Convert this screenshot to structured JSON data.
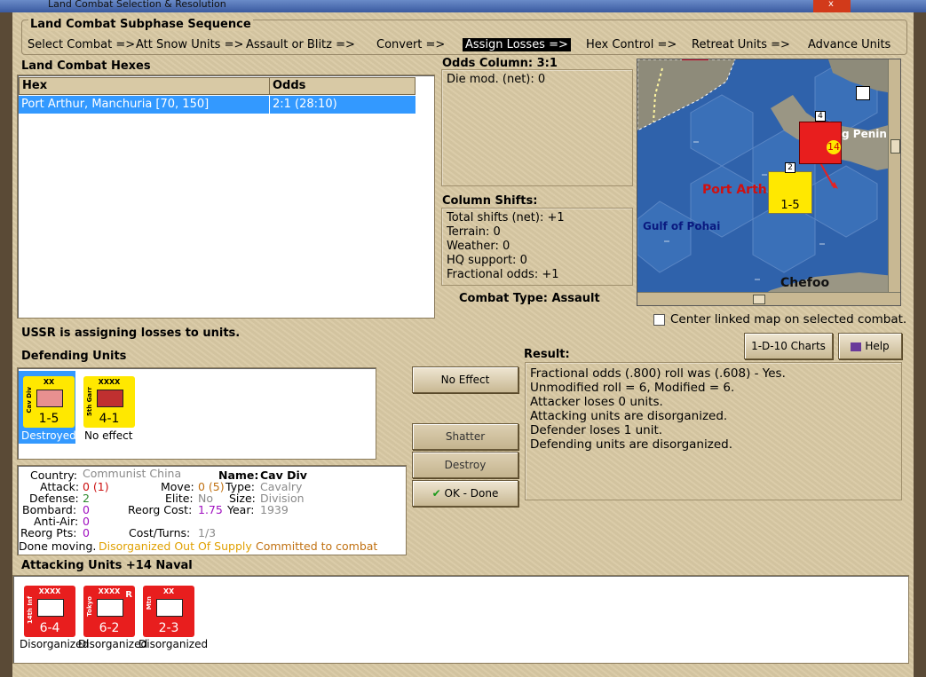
{
  "window": {
    "title": "Land Combat Selection & Resolution",
    "close_label": "x"
  },
  "sequence": {
    "title": "Land Combat Subphase Sequence",
    "steps": [
      {
        "label": "Select Combat =>",
        "active": false
      },
      {
        "label": "Att Snow Units =>",
        "active": false
      },
      {
        "label": "Assault or Blitz =>",
        "active": false
      },
      {
        "label": "Convert =>",
        "active": false
      },
      {
        "label": "Assign Losses =>",
        "active": true
      },
      {
        "label": "Hex Control =>",
        "active": false
      },
      {
        "label": "Retreat Units =>",
        "active": false
      },
      {
        "label": "Advance Units",
        "active": false
      }
    ]
  },
  "hexes": {
    "title": "Land Combat Hexes",
    "columns": [
      "Hex",
      "Odds"
    ],
    "rows": [
      {
        "hex": "Port Arthur, Manchuria [70, 150]",
        "odds": "2:1 (28:10)"
      }
    ]
  },
  "odds_column": {
    "title": "Odds Column: 3:1",
    "die_mod": "Die mod. (net): 0"
  },
  "column_shifts": {
    "title": "Column Shifts:",
    "lines": [
      "Total shifts (net): +1",
      "Terrain: 0",
      "Weather: 0",
      "HQ support: 0",
      "Fractional odds: +1"
    ]
  },
  "combat_type": "Combat Type:  Assault",
  "map": {
    "labels": {
      "port": "Port Arth",
      "gulf": "Gulf of Pohai",
      "chefoo": "Chefoo",
      "penin": "g Penin"
    },
    "unit_count_top": "4",
    "unit_count_mid": "2",
    "mid_counter_value": "1-5",
    "top_counter_value": "14",
    "colors": {
      "sea": "#2a5fa8",
      "land": "#8a8674",
      "port_label": "#d01010"
    }
  },
  "center_linked": {
    "label": "Center linked map on selected combat.",
    "checked": false
  },
  "buttons": {
    "charts": "1-D-10 Charts",
    "help": "Help",
    "no_effect": "No Effect",
    "shatter": "Shatter",
    "destroy": "Destroy",
    "ok_done": "OK - Done"
  },
  "status_message": "USSR is assigning losses to units.",
  "defending": {
    "title": "Defending Units",
    "units": [
      {
        "name": "Cav Div",
        "size": "XX",
        "value": "1-5",
        "status": "Destroyed",
        "color": "#ffe800",
        "selected": true
      },
      {
        "name": "5th Garr",
        "size": "XXXX",
        "value": "4-1",
        "status": "No effect",
        "color": "#ffe800",
        "selected": false
      }
    ]
  },
  "info": {
    "country_label": "Country:",
    "country": "Communist China",
    "name_label": "Name:",
    "name": "Cav Div",
    "attack_label": "Attack:",
    "attack": "0 (1)",
    "move_label": "Move:",
    "move": "0 (5)",
    "type_label": "Type:",
    "type": "Cavalry",
    "defense_label": "Defense:",
    "defense": "2",
    "elite_label": "Elite:",
    "elite": "No",
    "size_label": "Size:",
    "size": "Division",
    "bombard_label": "Bombard:",
    "bombard": "0",
    "reorg_cost_label": "Reorg Cost:",
    "reorg_cost": "1.75",
    "year_label": "Year:",
    "year": "1939",
    "antiair_label": "Anti-Air:",
    "antiair": "0",
    "reorg_pts_label": "Reorg Pts:",
    "reorg_pts": "0",
    "cost_turns_label": "Cost/Turns:",
    "cost_turns": "1/3",
    "done_moving": "Done moving.",
    "flags_orange1": "Disorganized Out Of Supply",
    "flags_orange2": "Committed to combat"
  },
  "result": {
    "title": "Result:",
    "lines": [
      "Fractional odds (.800) roll was (.608)  - Yes.",
      "Unmodified roll = 6, Modified = 6.",
      "Attacker loses 0 units.",
      "Attacking units are disorganized.",
      "Defender loses 1 unit.",
      "Defending units are disorganized."
    ]
  },
  "attacking": {
    "title": "Attacking Units +14 Naval",
    "units": [
      {
        "name": "14th Inf",
        "size": "XXXX",
        "value": "6-4",
        "status": "Disorganized",
        "color": "#e81e1e"
      },
      {
        "name": "Tokyo",
        "size": "XXXX",
        "value": "6-2",
        "status": "Disorganized",
        "color": "#e81e1e",
        "marker": "R"
      },
      {
        "name": "Mtn",
        "size": "XX",
        "value": "2-3",
        "status": "Disorganized",
        "color": "#e81e1e"
      }
    ]
  }
}
